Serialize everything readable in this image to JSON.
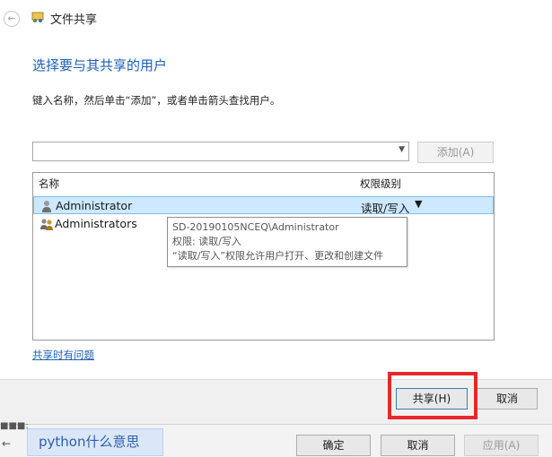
{
  "window": {
    "title": "文件共享",
    "back_glyph": "←"
  },
  "main": {
    "heading": "选择要与其共享的用户",
    "instruction": "键入名称，然后单击“添加”，或者单击箭头查找用户。",
    "name_input": {
      "value": ""
    },
    "add_button": "添加(A)",
    "help_link": "共享时有问题"
  },
  "user_list": {
    "columns": {
      "name": "名称",
      "permission": "权限级别"
    },
    "rows": [
      {
        "name": "Administrator",
        "permission": "读取/写入",
        "icon": "user-icon",
        "selected": true
      },
      {
        "name": "Administrators",
        "permission": "",
        "icon": "group-icon",
        "selected": false
      }
    ]
  },
  "tooltip": {
    "line1": "SD-20190105NCEQ\\Administrator",
    "line2": "权限: 读取/写入",
    "line3": "“读取/写入”权限允许用户打开、更改和创建文件"
  },
  "footer": {
    "share_button": "共享(H)",
    "cancel_button": "取消"
  },
  "background": {
    "fragment_text": "■■■:",
    "tab_label": "python什么意思",
    "ok_button": "确定",
    "cancel_button": "取消",
    "apply_button": "应用(A)"
  },
  "colors": {
    "heading": "#1e5fb4",
    "selection": "#cde8ff",
    "highlight_box": "#e8262e"
  }
}
